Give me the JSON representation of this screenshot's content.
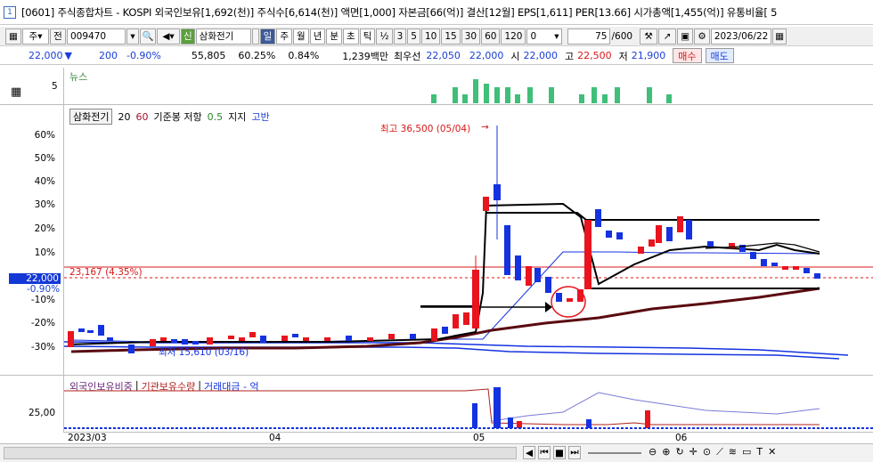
{
  "window": {
    "number": "1",
    "title": "[0601] 주식종합차트 - KOSPI 외국인보유[1,692(천)] 주식수[6,614(천)] 액면[1,000] 자본금[66(억)] 결산[12월] EPS[1,611] PER[13.66] 시가총액[1,455(억)] 유통비율[ 5"
  },
  "toolbar": {
    "market_type": "주",
    "market_dropdown": "▾",
    "all_label": "전",
    "code": "009470",
    "stock_badge": "신",
    "stock_name": "삼화전기",
    "period_day": "일",
    "period_week": "주",
    "period_month": "월",
    "period_year": "년",
    "period_minute": "분",
    "period_second": "초",
    "period_tick": "틱",
    "fraction": "½",
    "minute_steps": [
      "3",
      "5",
      "10",
      "15",
      "30",
      "60",
      "120"
    ],
    "zero_value": "0",
    "count": "75",
    "total": "/600",
    "date": "2023/06/22"
  },
  "quote": {
    "price": "22,000",
    "change": "200",
    "change_pct": "-0.90%",
    "volume": "55,805",
    "vol_ratio": "60.25%",
    "turnover": "0.84%",
    "amount": "1,239백만",
    "best_label": "최우선",
    "best_value": "22,050",
    "open_value": "22,000",
    "open_label": "시",
    "open_price": "22,000",
    "high_label": "고",
    "high_price": "22,500",
    "low_label": "저",
    "low_price": "21,900",
    "buy_label": "매수",
    "sell_label": "매도"
  },
  "news": {
    "label": "뉴스",
    "scale": "5"
  },
  "chart": {
    "legend_name": "삼화전기",
    "legend_ma1": "20",
    "legend_ma2": "60",
    "legend_base": "기준봉 저항",
    "legend_pct": "0.5",
    "legend_support": "지지",
    "legend_high": "고반",
    "high_note": "최고 36,500 (05/04)",
    "low_note": "최저 15,610 (03/16)",
    "ref_line": "23,167 (4.35%)",
    "current_price": "22,000",
    "current_pct": "-0.90%",
    "y_ticks": [
      "60%",
      "50%",
      "40%",
      "30%",
      "20%",
      "10%",
      "-10%",
      "-20%",
      "-30%"
    ],
    "sub_legend_a": "외국인보유비중",
    "sub_legend_b": "기관보유수량",
    "sub_legend_c": "거래대금 - 억",
    "sub_scale": "25,00",
    "x_labels": [
      "2023/03",
      "04",
      "05",
      "06"
    ]
  },
  "colors": {
    "up": "#e8141e",
    "down": "#1432e0",
    "ma": "#000000"
  }
}
